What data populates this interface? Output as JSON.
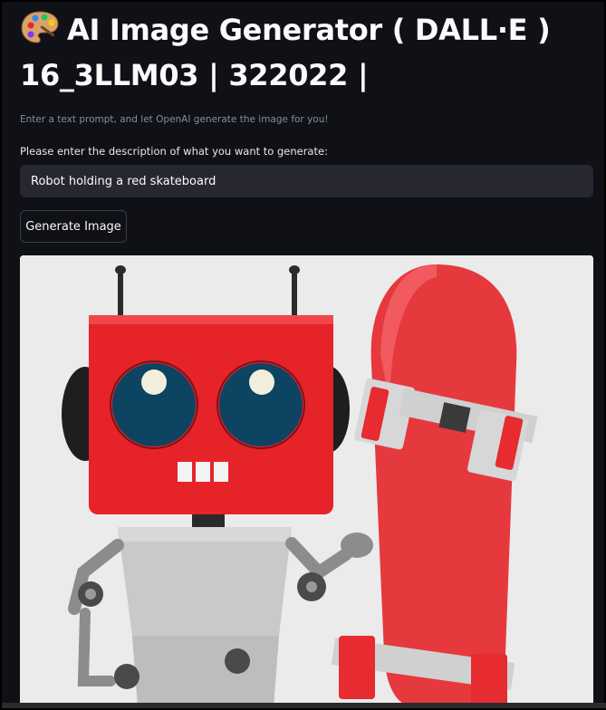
{
  "header": {
    "title_line1": "AI Image Generator ( DALL·E )",
    "title_line2": "16_3LLM03 | 322022 |",
    "emoji_icon": "artist-palette-icon"
  },
  "subtitle": "Enter a text prompt, and let OpenAI generate the image for you!",
  "prompt": {
    "label": "Please enter the description of what you want to generate:",
    "value": "Robot holding a red skateboard"
  },
  "generate_button": {
    "label": "Generate Image"
  },
  "generated_image": {
    "subject": "robot-with-red-skateboard"
  },
  "colors": {
    "background": "#0f1117",
    "input_bg": "#262730",
    "robot_red": "#e8262b",
    "eye_blue": "#0f4a6a",
    "board_red": "#ee3a3f"
  }
}
